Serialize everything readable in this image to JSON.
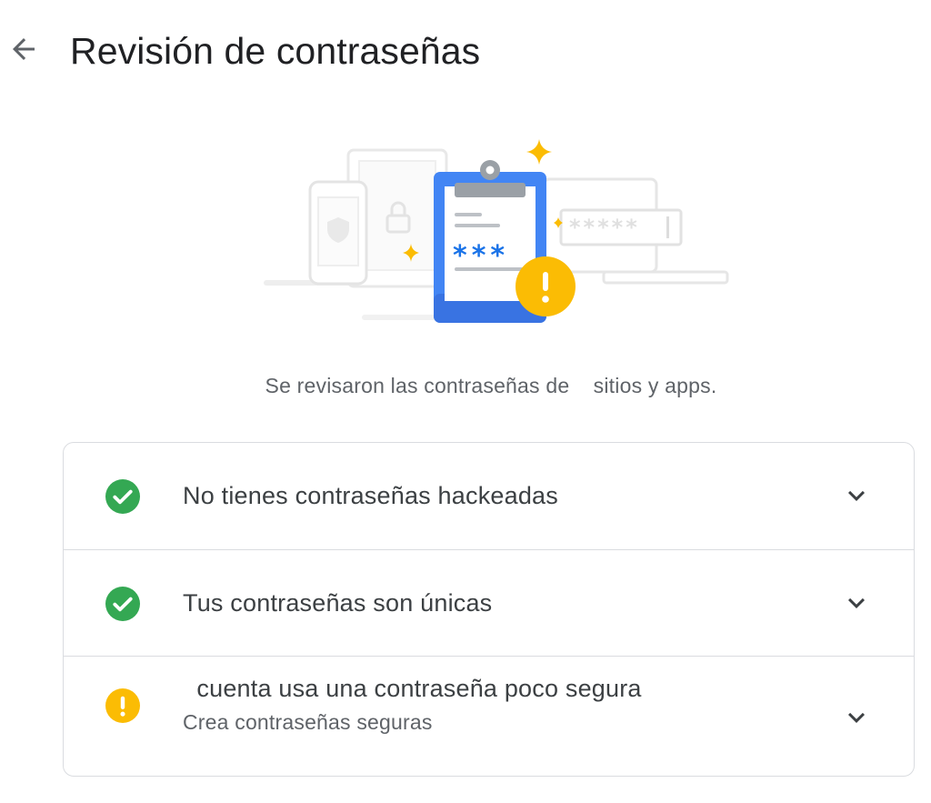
{
  "header": {
    "back_label": "Atrás",
    "title": "Revisión de contraseñas"
  },
  "illustration": {
    "name": "password-checkup-illustration",
    "masked_password": "*****",
    "clipboard_stars": "***",
    "alert_mark": "!"
  },
  "summary": {
    "text": "Se revisaron las contraseñas de    sitios y apps."
  },
  "results": [
    {
      "status": "ok",
      "icon": "check-circle-icon",
      "title": "No tienes contraseñas hackeadas",
      "subtitle": ""
    },
    {
      "status": "ok",
      "icon": "check-circle-icon",
      "title": "Tus contraseñas son únicas",
      "subtitle": ""
    },
    {
      "status": "warning",
      "icon": "warning-circle-icon",
      "title": "  cuenta usa una contraseña poco segura",
      "subtitle": "Crea contraseñas seguras"
    }
  ],
  "colors": {
    "ok": "#34a853",
    "warning": "#fbbc04",
    "brand_blue": "#4285f4",
    "text_primary": "#202124",
    "text_secondary": "#5f6368",
    "divider": "#dadce0"
  }
}
